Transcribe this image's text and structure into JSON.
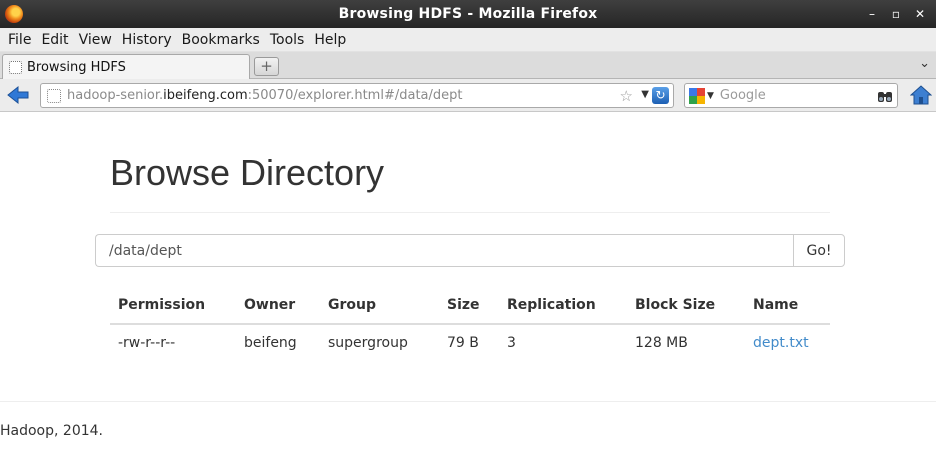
{
  "window": {
    "title": "Browsing HDFS - Mozilla Firefox",
    "controls": {
      "minimize": "–",
      "maximize": "▫",
      "close": "✕"
    }
  },
  "menubar": {
    "items": [
      {
        "label": "File"
      },
      {
        "label": "Edit"
      },
      {
        "label": "View"
      },
      {
        "label": "History"
      },
      {
        "label": "Bookmarks"
      },
      {
        "label": "Tools"
      },
      {
        "label": "Help"
      }
    ]
  },
  "tabs": {
    "active": {
      "label": "Browsing HDFS"
    },
    "new_tab_glyph": "+",
    "list_glyph": "⌄"
  },
  "navbar": {
    "url": {
      "prefix": "hadoop-senior.",
      "host": "ibeifeng.com",
      "suffix": ":50070/explorer.html#/data/dept"
    },
    "star_glyph": "☆",
    "dropdown_glyph": "▼",
    "reload_glyph": "↻",
    "search": {
      "placeholder": "Google"
    },
    "icons": {
      "back": "back-arrow-icon",
      "search_engine": "google-icon",
      "search_go": "binoculars-icon",
      "home": "home-icon"
    }
  },
  "page": {
    "heading": "Browse Directory",
    "path_input": {
      "value": "/data/dept"
    },
    "go_label": "Go!",
    "table": {
      "headers": [
        "Permission",
        "Owner",
        "Group",
        "Size",
        "Replication",
        "Block Size",
        "Name"
      ],
      "rows": [
        {
          "permission": "-rw-r--r--",
          "owner": "beifeng",
          "group": "supergroup",
          "size": "79 B",
          "replication": "3",
          "block_size": "128 MB",
          "name": "dept.txt"
        }
      ]
    },
    "footer": "Hadoop, 2014.",
    "colors": {
      "link": "#428bca",
      "text": "#333333"
    }
  }
}
